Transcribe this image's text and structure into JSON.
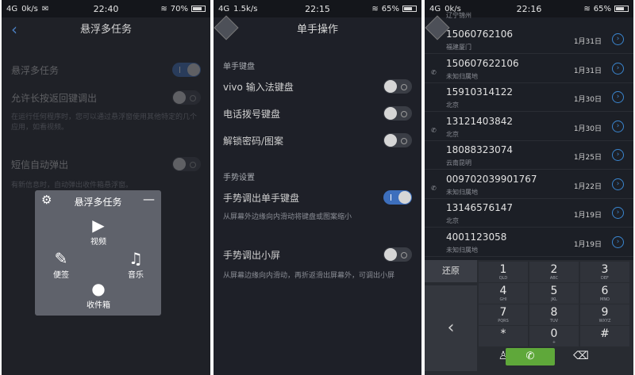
{
  "s1": {
    "status": {
      "net": "4G",
      "speed": "0k/s",
      "time": "22:40",
      "battery": "70%"
    },
    "title": "悬浮多任务",
    "r1": "悬浮多任务",
    "r2": "允许长按返回键调出",
    "r2desc": "在运行任何程序时，您可以通过悬浮窗使用其他特定的几个应用，如看视频。",
    "r3": "短信自动弹出",
    "r3desc": "有新信息时，自动弹出收件箱悬浮窗。",
    "popup": {
      "title": "悬浮多任务",
      "video": "视频",
      "notes": "便签",
      "music": "音乐",
      "inbox": "收件箱"
    }
  },
  "s2": {
    "status": {
      "net": "4G",
      "speed": "1.5k/s",
      "time": "22:15",
      "battery": "65%"
    },
    "title": "单手操作",
    "sec1": "单手键盘",
    "k1": "vivo 输入法键盘",
    "k2": "电话拨号键盘",
    "k3": "解锁密码/图案",
    "sec2": "手势设置",
    "g1": "手势调出单手键盘",
    "g1desc": "从屏幕外边缘向内滑动将键盘或图案缩小",
    "g2": "手势调出小屏",
    "g2desc": "从屏幕边缘向内滑动，再折返滑出屏幕外，可调出小屏"
  },
  "s3": {
    "status": {
      "net": "4G",
      "speed": "0k/s",
      "time": "22:16",
      "battery": "65%"
    },
    "top_loc": "辽宁锦州",
    "calls": [
      {
        "num": "15060762106",
        "loc": "福建厦门",
        "date": "1月31日"
      },
      {
        "num": "150607622106",
        "loc": "未知归属地",
        "date": "1月31日"
      },
      {
        "num": "15910314122",
        "loc": "北京",
        "date": "1月30日"
      },
      {
        "num": "13121403842",
        "loc": "北京",
        "date": "1月30日"
      },
      {
        "num": "18088323074",
        "loc": "云南昆明",
        "date": "1月25日"
      },
      {
        "num": "009702039901767",
        "loc": "未知归属地",
        "date": "1月22日"
      },
      {
        "num": "13146576147",
        "loc": "北京",
        "date": "1月19日"
      },
      {
        "num": "4001123058",
        "loc": "未知归属地",
        "date": "1月19日"
      }
    ],
    "restore": "还原",
    "keys": [
      [
        "1",
        "QLD"
      ],
      [
        "2",
        "ABC"
      ],
      [
        "3",
        "DEF"
      ],
      [
        "4",
        "GHI"
      ],
      [
        "5",
        "JKL"
      ],
      [
        "6",
        "MNO"
      ],
      [
        "7",
        "PQRS"
      ],
      [
        "8",
        "TUV"
      ],
      [
        "9",
        "WXYZ"
      ],
      [
        "*",
        ""
      ],
      [
        "0",
        "+"
      ],
      [
        "#",
        ""
      ]
    ]
  }
}
